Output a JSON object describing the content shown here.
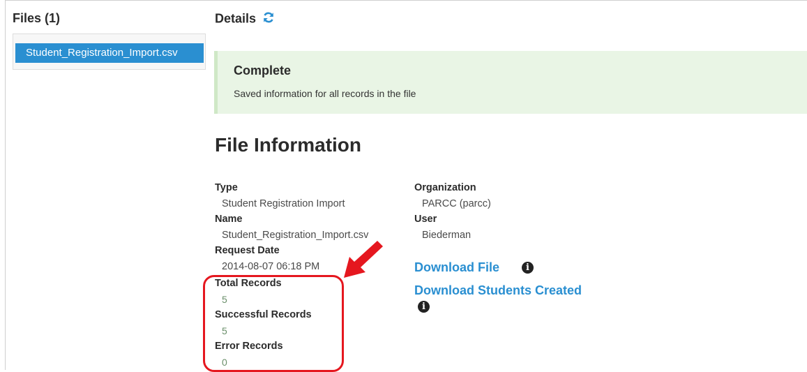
{
  "files": {
    "title": "Files (1)",
    "items": [
      {
        "label": "Student_Registration_Import.csv",
        "selected": true
      }
    ]
  },
  "details": {
    "title": "Details",
    "refresh_icon": "refresh-icon"
  },
  "alert": {
    "title": "Complete",
    "message": "Saved information for all records in the file",
    "color": "#e9f5e5"
  },
  "file_information": {
    "heading": "File Information",
    "type_label": "Type",
    "type_value": "Student Registration Import",
    "name_label": "Name",
    "name_value": "Student_Registration_Import.csv",
    "request_date_label": "Request Date",
    "request_date_value": "2014-08-07 06:18 PM",
    "total_records_label": "Total Records",
    "total_records_value": "5",
    "successful_records_label": "Successful Records",
    "successful_records_value": "5",
    "error_records_label": "Error Records",
    "error_records_value": "0",
    "organization_label": "Organization",
    "organization_value": "PARCC (parcc)",
    "user_label": "User",
    "user_value": "Biederman"
  },
  "links": {
    "download_file": "Download File",
    "download_students_created": "Download Students Created",
    "info_icon": "info-circle-icon"
  },
  "colors": {
    "accent": "#2a8fd1",
    "annotation": "#e5171f"
  }
}
